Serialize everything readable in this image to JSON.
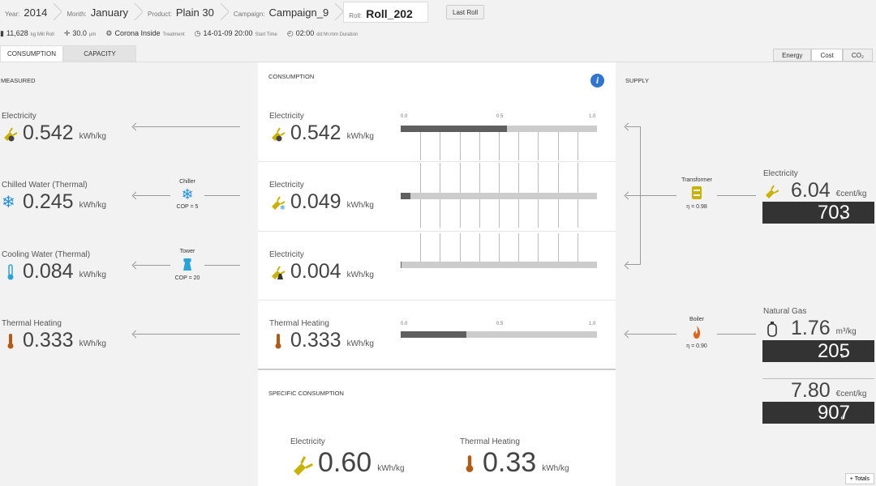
{
  "header": {
    "crumbs": [
      {
        "label": "Year:",
        "value": "2014"
      },
      {
        "label": "Month:",
        "value": "January"
      },
      {
        "label": "Product:",
        "value": "Plain 30"
      },
      {
        "label": "Campaign:",
        "value": "Campaign_9"
      },
      {
        "label": "Roll:",
        "value": "Roll_202"
      }
    ],
    "last_roll": "Last Roll",
    "meta": {
      "mill_roll_value": "11,628",
      "mill_roll_unit": "kg Mill Roll",
      "thickness_value": "30.0",
      "thickness_unit": "µm",
      "treatment_value": "Corona Inside",
      "treatment_unit": "Treatment",
      "start_value": "14-01-09 20:00",
      "start_unit": "Start Time",
      "duration_value": "02:00",
      "duration_unit": "dd:hh:mm Duration"
    }
  },
  "tabs": [
    "CONSUMPTION",
    "CAPACITY"
  ],
  "toggles": [
    "Energy",
    "Cost",
    "CO₂"
  ],
  "measured": {
    "title": "MEASURED",
    "rows": [
      {
        "name": "Electricity",
        "value": "0.542",
        "unit": "kWh/kg"
      },
      {
        "name": "Chilled Water (Thermal)",
        "value": "0.245",
        "unit": "kWh/kg",
        "converter": "Chiller",
        "cop": "COP = 5"
      },
      {
        "name": "Cooling Water (Thermal)",
        "value": "0.084",
        "unit": "kWh/kg",
        "converter": "Tower",
        "cop": "COP = 20"
      },
      {
        "name": "Thermal Heating",
        "value": "0.333",
        "unit": "kWh/kg"
      }
    ]
  },
  "consumption": {
    "title": "CONSUMPTION",
    "rows": [
      {
        "name": "Electricity",
        "value": "0.542",
        "unit": "kWh/kg",
        "fraction": 0.542
      },
      {
        "name": "Electricity",
        "value": "0.049",
        "unit": "kWh/kg",
        "fraction": 0.049
      },
      {
        "name": "Electricity",
        "value": "0.004",
        "unit": "kWh/kg",
        "fraction": 0.004
      },
      {
        "name": "Thermal Heating",
        "value": "0.333",
        "unit": "kWh/kg",
        "fraction": 0.333
      }
    ],
    "ticks": [
      "0.0",
      "0.5",
      "1.0"
    ]
  },
  "specific": {
    "title": "SPECIFIC CONSUMPTION",
    "items": [
      {
        "name": "Electricity",
        "value": "0.60",
        "unit": "kWh/kg"
      },
      {
        "name": "Thermal Heating",
        "value": "0.33",
        "unit": "kWh/kg"
      }
    ]
  },
  "supply": {
    "title": "SUPPLY",
    "transformer": {
      "label": "Transformer",
      "eta": "η = 0.98"
    },
    "boiler": {
      "label": "Boiler",
      "eta": "η = 0.90"
    },
    "electricity": {
      "name": "Electricity",
      "value": "6.04",
      "unit": "€cent/kg",
      "cost": "703",
      "currency": "€"
    },
    "gas": {
      "name": "Natural Gas",
      "value": "1.76",
      "unit": "m³/kg",
      "cost": "205",
      "currency": "€"
    },
    "total": {
      "value": "7.80",
      "unit": "€cent/kg",
      "cost": "907",
      "currency": "€"
    }
  },
  "totals_button": "+ Totals",
  "colors": {
    "electric": "#c9b200",
    "chilled": "#1e8fdc",
    "cooling": "#2aa3d8",
    "thermal": "#b45a12",
    "flame": "#e0621b"
  }
}
